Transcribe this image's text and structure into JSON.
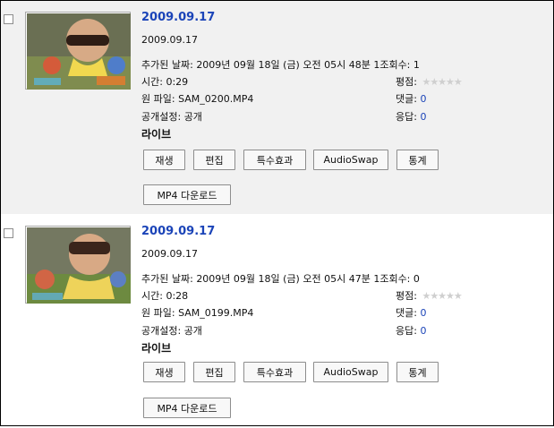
{
  "videos": [
    {
      "title": "2009.09.17",
      "description": "2009.09.17",
      "added_label": "추가된 날짜:",
      "added_value": "2009년 09월 18일 (금) 오전 05시 48분",
      "views_label": "1조회수:",
      "views_value": "1",
      "duration_label": "시간:",
      "duration_value": "0:29",
      "source_label": "원 파일:",
      "source_value": "SAM_0200.MP4",
      "privacy_label": "공개설정:",
      "privacy_value": "공개",
      "status": "라이브",
      "rating_label": "평점:",
      "comments_label": "댓글:",
      "comments_value": "0",
      "responses_label": "응답:",
      "responses_value": "0",
      "buttons": {
        "play": "재생",
        "edit": "편집",
        "effects": "특수효과",
        "audioswap": "AudioSwap",
        "stats": "통계",
        "download": "MP4 다운로드"
      }
    },
    {
      "title": "2009.09.17",
      "description": "2009.09.17",
      "added_label": "추가된 날짜:",
      "added_value": "2009년 09월 18일 (금) 오전 05시 47분",
      "views_label": "1조회수:",
      "views_value": "0",
      "duration_label": "시간:",
      "duration_value": "0:28",
      "source_label": "원 파일:",
      "source_value": "SAM_0199.MP4",
      "privacy_label": "공개설정:",
      "privacy_value": "공개",
      "status": "라이브",
      "rating_label": "평점:",
      "comments_label": "댓글:",
      "comments_value": "0",
      "responses_label": "응답:",
      "responses_value": "0",
      "buttons": {
        "play": "재생",
        "edit": "편집",
        "effects": "특수효과",
        "audioswap": "AudioSwap",
        "stats": "통계",
        "download": "MP4 다운로드"
      }
    }
  ],
  "colors": {
    "link": "#1b44b8",
    "alt_row": "#f1f1f1",
    "stars": "#cfcfcf"
  }
}
